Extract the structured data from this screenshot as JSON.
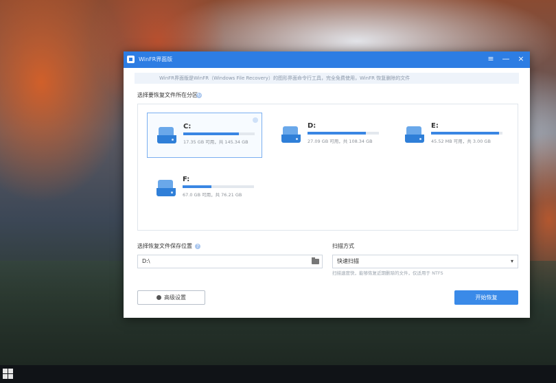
{
  "window": {
    "title": "WinFR界面版",
    "controls": [
      "≡",
      "—",
      "×"
    ]
  },
  "banner": {
    "text": "WinFR界面版是WinFR（Windows File Recovery）的图形界面命令行工具，完全免费使用，WinFR 恢复删除的文件"
  },
  "drives_section": {
    "label": "选择要恢复文件所在分区"
  },
  "drives": [
    {
      "letter": "C:",
      "usage_fraction": 0.78,
      "size_text": "17.35 GB 可用，共 145.34 GB",
      "selected": true
    },
    {
      "letter": "D:",
      "usage_fraction": 0.82,
      "size_text": "27.09 GB 可用，共 108.34 GB",
      "selected": false
    },
    {
      "letter": "E:",
      "usage_fraction": 0.95,
      "size_text": "45.52 MB 可用，共 3.00 GB",
      "selected": false
    },
    {
      "letter": "F:",
      "usage_fraction": 0.4,
      "size_text": "67.0 GB 可用，共 76.21 GB",
      "selected": false
    }
  ],
  "save_location": {
    "label": "选择恢复文件保存位置",
    "value": "D:\\"
  },
  "scan_mode": {
    "label": "扫描方式",
    "value": "快速扫描",
    "hint": "扫描速度快，能够恢复近期删除的文件，仅适用于 NTFS"
  },
  "buttons": {
    "advanced": "高级设置",
    "start": "开始恢复"
  },
  "colors": {
    "accent": "#2d7de3",
    "button": "#3a8ae8"
  }
}
